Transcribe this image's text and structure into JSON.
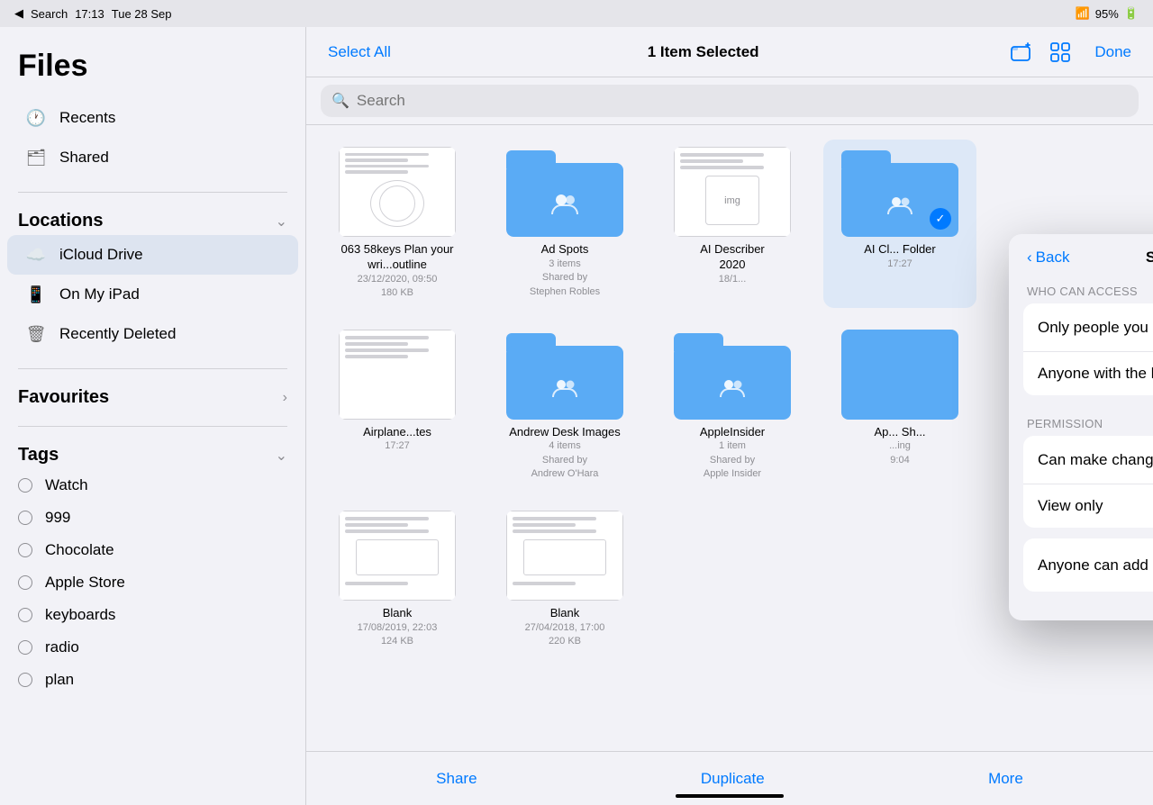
{
  "statusBar": {
    "leftItems": [
      "◀",
      "Search"
    ],
    "time": "17:13",
    "date": "Tue 28 Sep",
    "wifi": "WiFi",
    "battery": "95%"
  },
  "sidebar": {
    "title": "Files",
    "navItems": [
      {
        "id": "recents",
        "icon": "🕐",
        "label": "Recents"
      },
      {
        "id": "shared",
        "icon": "🗂",
        "label": "Shared"
      }
    ],
    "locationsTitle": "Locations",
    "locationItems": [
      {
        "id": "icloud",
        "icon": "☁️",
        "label": "iCloud Drive",
        "active": true
      },
      {
        "id": "ipad",
        "icon": "📱",
        "label": "On My iPad"
      },
      {
        "id": "deleted",
        "icon": "🗑",
        "label": "Recently Deleted"
      }
    ],
    "favouritesTitle": "Favourites",
    "tagsTitle": "Tags",
    "tagItems": [
      {
        "id": "watch",
        "label": "Watch"
      },
      {
        "id": "999",
        "label": "999"
      },
      {
        "id": "chocolate",
        "label": "Chocolate"
      },
      {
        "id": "apple-store",
        "label": "Apple Store"
      },
      {
        "id": "keyboards",
        "label": "keyboards"
      },
      {
        "id": "radio",
        "label": "radio"
      },
      {
        "id": "plan",
        "label": "plan"
      }
    ]
  },
  "toolbar": {
    "selectAll": "Select All",
    "itemCount": "1 Item Selected",
    "done": "Done"
  },
  "search": {
    "placeholder": "Search"
  },
  "files": [
    {
      "id": "f1",
      "type": "doc",
      "name": "063 58keys Plan your wri...outline",
      "meta": "23/12/2020, 09:50\n180 KB"
    },
    {
      "id": "f2",
      "type": "folder-shared",
      "name": "Ad Spots",
      "meta": "3 items\nShared by\nStephen Robles"
    },
    {
      "id": "f3",
      "type": "doc",
      "name": "AI Describer 2020",
      "meta": "18/1..."
    },
    {
      "id": "f4",
      "type": "folder-selected",
      "name": "AI Cl... Folder",
      "meta": "17:27",
      "selected": true
    },
    {
      "id": "f5",
      "type": "doc",
      "name": "Airplane...tes",
      "meta": "17:27"
    },
    {
      "id": "f6",
      "type": "folder-shared",
      "name": "Andrew Desk Images",
      "meta": "4 items\nShared by\nAndrew O'Hara"
    },
    {
      "id": "f7",
      "type": "folder-shared",
      "name": "AppleInsider",
      "meta": "1 item\nShared by\nApple Insider"
    },
    {
      "id": "f8",
      "type": "doc-partial",
      "name": "Ap... Sh...",
      "meta": "...ing\n...9:04"
    },
    {
      "id": "f9",
      "type": "doc",
      "name": "Blank",
      "meta": "17/08/2019, 22:03\n124 KB"
    },
    {
      "id": "f10",
      "type": "doc",
      "name": "Blank",
      "meta": "27/04/2018, 17:00\n220 KB"
    },
    {
      "id": "f11",
      "type": "doc",
      "name": "...",
      "meta": "..."
    }
  ],
  "bottomBar": {
    "share": "Share",
    "duplicate": "Duplicate",
    "more": "More"
  },
  "sharePanel": {
    "backLabel": "Back",
    "title": "Share Options",
    "whoCanAccessLabel": "WHO CAN ACCESS",
    "accessOptions": [
      {
        "id": "invite-only",
        "label": "Only people you invite",
        "checked": true
      },
      {
        "id": "link",
        "label": "Anyone with the link",
        "checked": false
      }
    ],
    "permissionLabel": "PERMISSION",
    "permissionOptions": [
      {
        "id": "can-change",
        "label": "Can make changes",
        "checked": true
      },
      {
        "id": "view-only",
        "label": "View only",
        "checked": false
      }
    ],
    "addPeopleLabel": "Anyone can add people",
    "addPeopleEnabled": true
  }
}
